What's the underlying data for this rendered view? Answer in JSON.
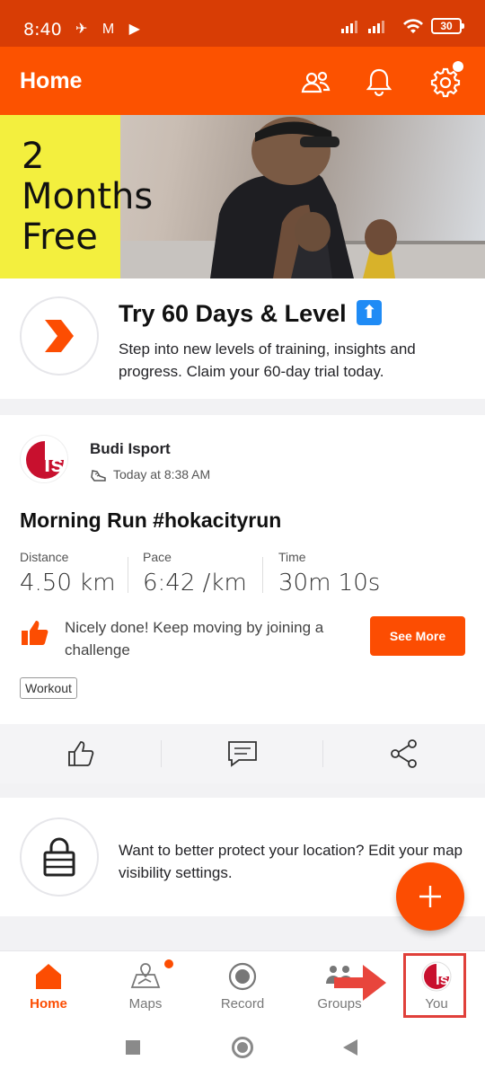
{
  "status": {
    "time": "8:40",
    "battery": "30"
  },
  "appbar": {
    "title": "Home"
  },
  "banner": {
    "line1": "2",
    "line2": "Months",
    "line3": "Free"
  },
  "trial": {
    "title": "Try 60 Days & Level",
    "up_icon": "⬆",
    "description": "Step into new levels of training, insights and progress. Claim your 60-day trial today."
  },
  "activity": {
    "athlete": "Budi Isport",
    "timestamp": "Today at 8:38 AM",
    "title": "Morning Run #hokacityrun",
    "stats": [
      {
        "label": "Distance",
        "value": "4.50 km"
      },
      {
        "label": "Pace",
        "value": "6:42 /km"
      },
      {
        "label": "Time",
        "value": "30m 10s"
      }
    ],
    "kudos_text": "Nicely done! Keep moving by joining a challenge",
    "see_more": "See More",
    "tag": "Workout"
  },
  "privacy": {
    "text": "Want to better protect your location? Edit your map visibility settings."
  },
  "nav": [
    {
      "label": "Home"
    },
    {
      "label": "Maps"
    },
    {
      "label": "Record"
    },
    {
      "label": "Groups"
    },
    {
      "label": "You"
    }
  ],
  "colors": {
    "brand": "#fc4d02",
    "status_bar": "#d83d05",
    "promo_yellow": "#f3ef3e"
  }
}
